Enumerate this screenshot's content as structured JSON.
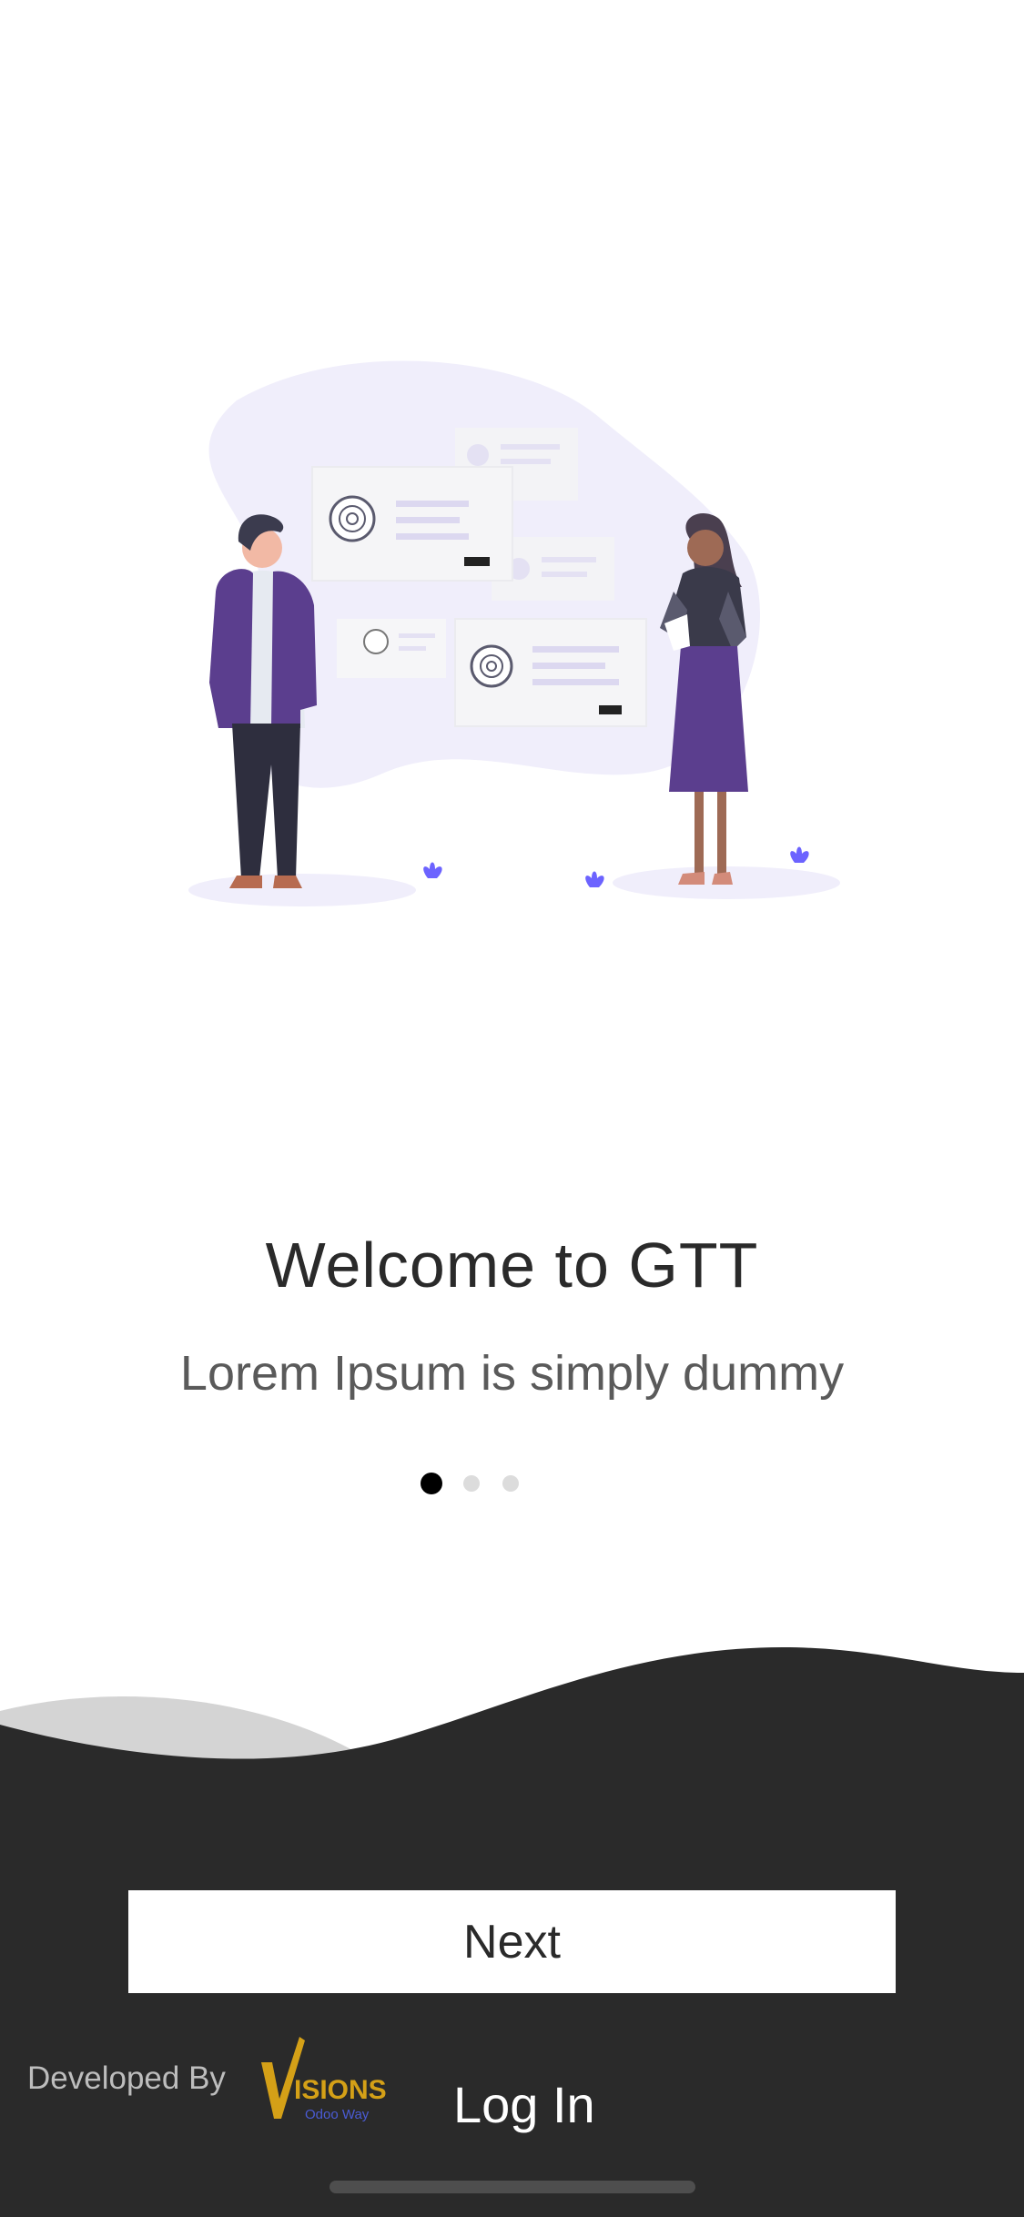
{
  "onboarding": {
    "title": "Welcome to GTT",
    "subtitle": "Lorem Ipsum is simply dummy",
    "pager": {
      "total": 3,
      "active_index": 0
    }
  },
  "actions": {
    "next_label": "Next",
    "login_label": "Log In"
  },
  "footer": {
    "developed_by_label": "Developed By",
    "logo_text": "VISIONS",
    "logo_tagline": "Odoo Way"
  },
  "colors": {
    "background": "#ffffff",
    "footer_dark": "#2a2a2a",
    "wave_light": "#d4d4d4",
    "illustration_accent": "#5b3e8e",
    "illustration_blob": "#f0eefb",
    "dot_active": "#000000",
    "dot_inactive": "#dcdcdc"
  }
}
